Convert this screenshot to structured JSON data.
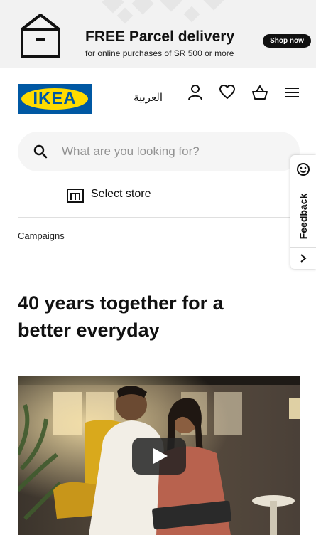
{
  "promo": {
    "title_bold": "FREE",
    "title_rest": "Parcel delivery",
    "subtitle": "for online purchases of SR 500 or more",
    "cta": "Shop now",
    "icon": "parcel-box-icon"
  },
  "header": {
    "logo_text": "IKEA",
    "language": "العربية",
    "icons": [
      "profile-icon",
      "heart-icon",
      "basket-icon",
      "menu-icon"
    ]
  },
  "search": {
    "placeholder": "What are you looking for?"
  },
  "store": {
    "label": "Select store",
    "icon": "store-icon"
  },
  "breadcrumb": "Campaigns",
  "headline": "40 years together for a better everyday",
  "video": {
    "play_icon": "play-icon"
  },
  "feedback": {
    "label": "Feedback"
  },
  "colors": {
    "ikea_blue": "#0058a3",
    "ikea_yellow": "#ffdb00",
    "promo_bg": "#f2f2f2",
    "search_bg": "#f5f5f5"
  }
}
